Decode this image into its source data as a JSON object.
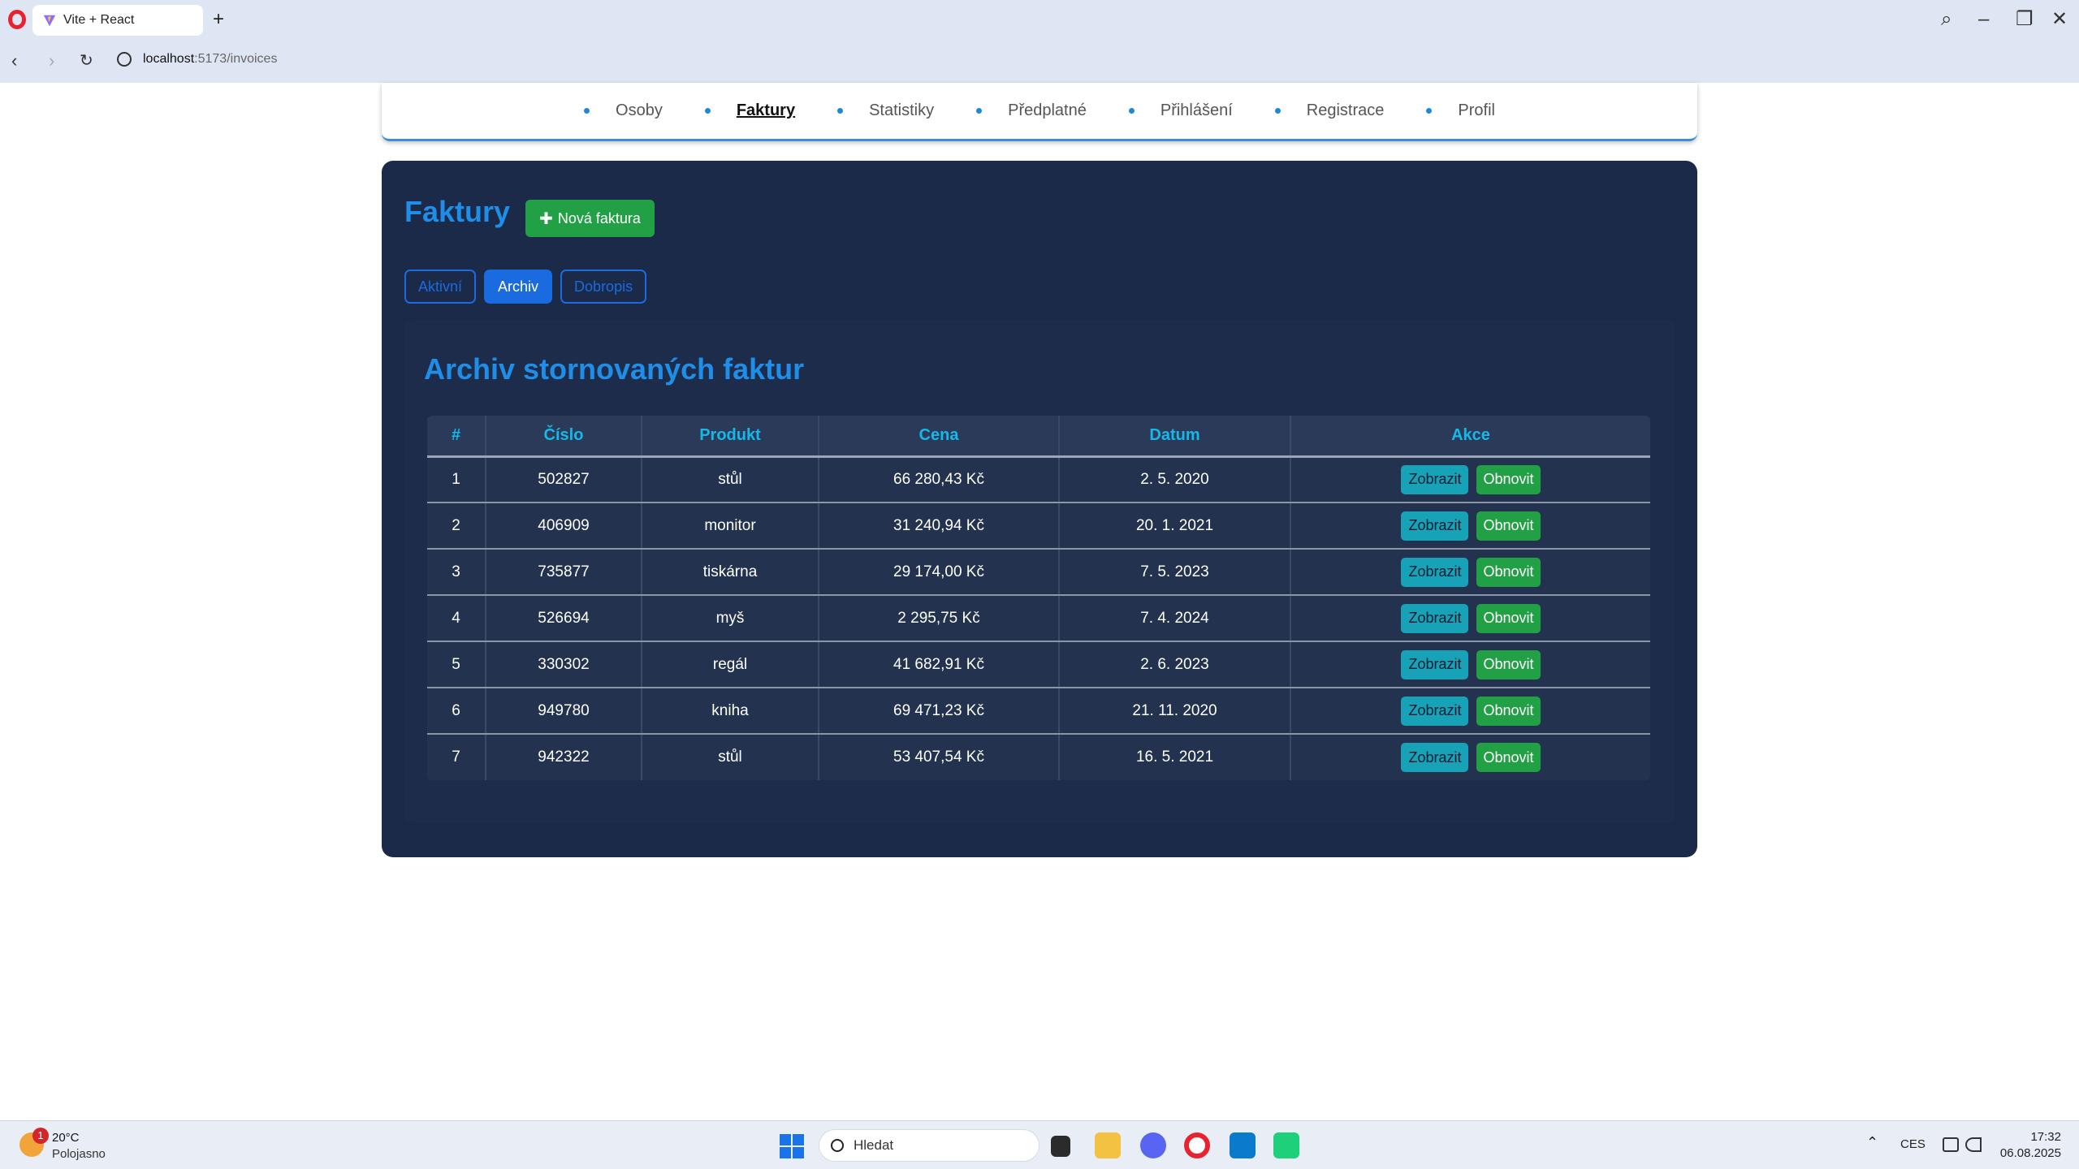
{
  "browser": {
    "tab_title": "Vite + React",
    "url_host": "localhost",
    "url_path": ":5173/invoices"
  },
  "nav": {
    "items": [
      {
        "label": "Osoby",
        "active": false
      },
      {
        "label": "Faktury",
        "active": true
      },
      {
        "label": "Statistiky",
        "active": false
      },
      {
        "label": "Předplatné",
        "active": false
      },
      {
        "label": "Přihlášení",
        "active": false
      },
      {
        "label": "Registrace",
        "active": false
      },
      {
        "label": "Profil",
        "active": false
      }
    ]
  },
  "page": {
    "title": "Faktury",
    "new_button": "Nová faktura",
    "tabs": [
      {
        "label": "Aktivní",
        "active": false
      },
      {
        "label": "Archiv",
        "active": true
      },
      {
        "label": "Dobropis",
        "active": false
      }
    ],
    "section_title": "Archiv stornovaných faktur"
  },
  "table": {
    "headers": [
      "#",
      "Číslo",
      "Produkt",
      "Cena",
      "Datum",
      "Akce"
    ],
    "show_label": "Zobrazit",
    "restore_label": "Obnovit",
    "rows": [
      [
        "1",
        "502827",
        "stůl",
        "66 280,43 Kč",
        "2. 5. 2020"
      ],
      [
        "2",
        "406909",
        "monitor",
        "31 240,94 Kč",
        "20. 1. 2021"
      ],
      [
        "3",
        "735877",
        "tiskárna",
        "29 174,00 Kč",
        "7. 5. 2023"
      ],
      [
        "4",
        "526694",
        "myš",
        "2 295,75 Kč",
        "7. 4. 2024"
      ],
      [
        "5",
        "330302",
        "regál",
        "41 682,91 Kč",
        "2. 6. 2023"
      ],
      [
        "6",
        "949780",
        "kniha",
        "69 471,23 Kč",
        "21. 11. 2020"
      ],
      [
        "7",
        "942322",
        "stůl",
        "53 407,54 Kč",
        "16. 5. 2021"
      ]
    ]
  },
  "taskbar": {
    "weather_badge": "1",
    "weather_temp": "20°C",
    "weather_desc": "Polojasno",
    "search_placeholder": "Hledat",
    "lang": "CES",
    "time": "17:32",
    "date": "06.08.2025"
  },
  "colors": {
    "accent_blue": "#1e8ee8",
    "panel_bg": "#1b2a48",
    "success_green": "#22a045",
    "info_cyan": "#17a2b8"
  }
}
